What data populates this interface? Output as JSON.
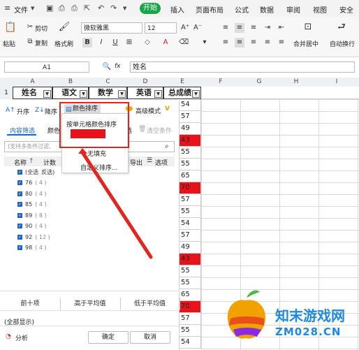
{
  "menubar": {
    "file": "文件",
    "tabs": [
      "开始",
      "插入",
      "页面布局",
      "公式",
      "数据",
      "审阅",
      "视图",
      "安全"
    ]
  },
  "toolbar": {
    "paste": "粘贴",
    "cut": "剪切",
    "copy": "复制",
    "format_painter": "格式刷",
    "font_name": "微软雅黑",
    "font_size": "12",
    "bold": "B",
    "italic": "I",
    "underline": "U",
    "merge_center": "合并居中",
    "auto_wrap": "自动换行"
  },
  "formula_bar": {
    "cell_ref": "A1",
    "fx": "fx",
    "content": "姓名"
  },
  "columns": [
    "A",
    "B",
    "C",
    "D",
    "E",
    "F",
    "G",
    "H",
    "I"
  ],
  "header_row": {
    "row_number": "1",
    "cells": [
      "姓名",
      "语文",
      "数学",
      "英语",
      "总成绩"
    ]
  },
  "column_e": [
    {
      "v": "54",
      "red": false
    },
    {
      "v": "57",
      "red": false
    },
    {
      "v": "49",
      "red": false
    },
    {
      "v": "43",
      "red": true
    },
    {
      "v": "55",
      "red": false
    },
    {
      "v": "55",
      "red": false
    },
    {
      "v": "65",
      "red": false
    },
    {
      "v": "70",
      "red": true
    },
    {
      "v": "57",
      "red": false
    },
    {
      "v": "55",
      "red": false
    },
    {
      "v": "54",
      "red": false
    },
    {
      "v": "57",
      "red": false
    },
    {
      "v": "49",
      "red": false
    },
    {
      "v": "43",
      "red": true
    },
    {
      "v": "55",
      "red": false
    },
    {
      "v": "55",
      "red": false
    },
    {
      "v": "65",
      "red": false
    },
    {
      "v": "70",
      "red": true
    },
    {
      "v": "57",
      "red": false
    },
    {
      "v": "55",
      "red": false
    },
    {
      "v": "54",
      "red": false
    }
  ],
  "filter_panel": {
    "sort_asc": "升序",
    "sort_desc": "降序",
    "color_sort": "颜色排序",
    "advanced_mode": "高级模式",
    "tab_content": "内容筛选",
    "tab_color_prefix": "颜色",
    "tab_suffix": "选",
    "clear_condition": "清空条件",
    "search_placeholder": "(支持多条件过滤,",
    "col_name": "名称",
    "col_count_prefix": "计数",
    "export": "导出",
    "options": "选项",
    "select_all": "(全选",
    "invert": "反选)",
    "values": [
      {
        "label": "76",
        "count": "( 4 )"
      },
      {
        "label": "80",
        "count": "( 4 )"
      },
      {
        "label": "85",
        "count": "( 4 )"
      },
      {
        "label": "89",
        "count": "( 8 )"
      },
      {
        "label": "90",
        "count": "( 4 )"
      },
      {
        "label": "92",
        "count": "( 12 )"
      },
      {
        "label": "98",
        "count": "( 4 )"
      }
    ],
    "top10": "前十项",
    "above_avg": "高于平均值",
    "below_avg": "低于平均值",
    "show_all": "(全部显示)",
    "analysis": "分析",
    "ok": "确定",
    "cancel": "取消"
  },
  "color_dropdown": {
    "by_cell_color": "按单元格颜色排序",
    "swatch_color": "#e8121b",
    "no_fill": "无填充",
    "custom_sort": "自定义排序..."
  },
  "watermark": {
    "name": "知末游戏网",
    "url": "ZM028.CN"
  }
}
